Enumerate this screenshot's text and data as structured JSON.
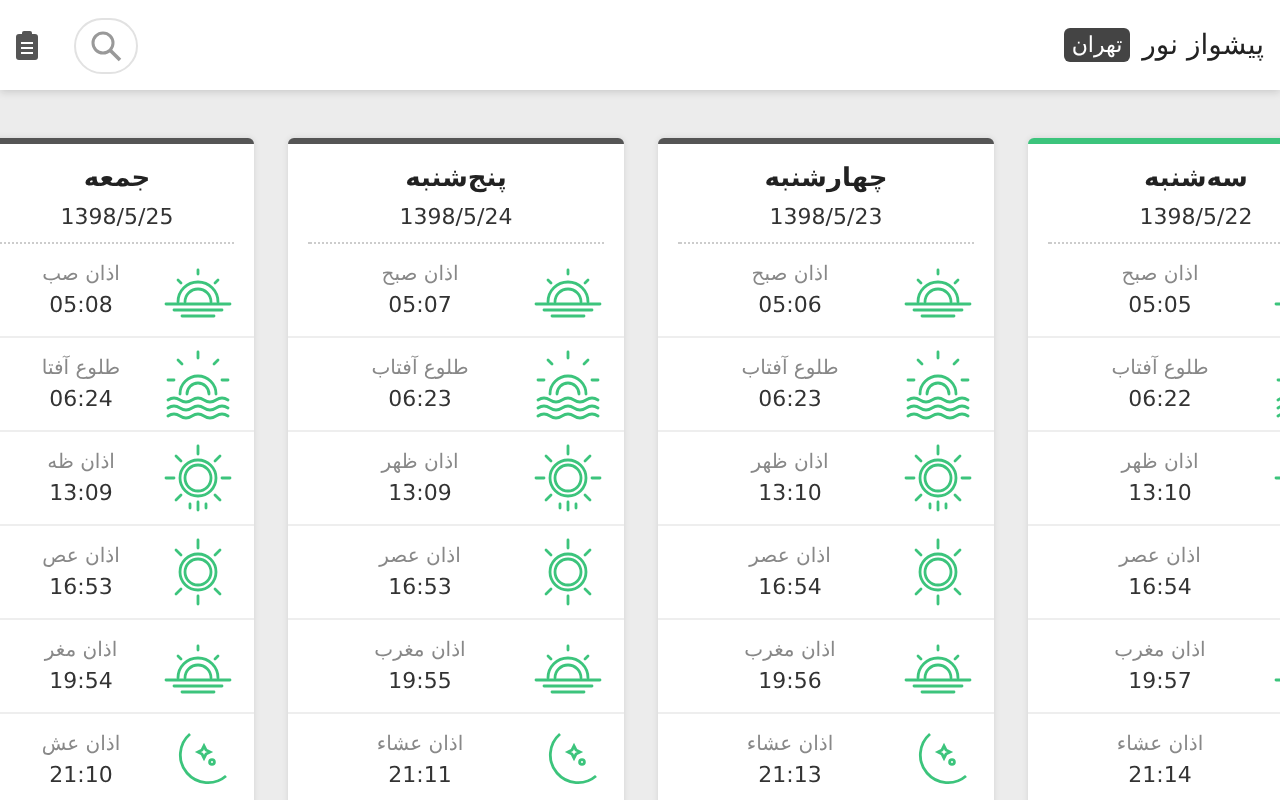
{
  "header": {
    "app_title": "پیشواز نور",
    "city": "تهران"
  },
  "days": [
    {
      "name": "سه‌شنبه",
      "date": "1398/5/22",
      "selected": true,
      "times": [
        {
          "kind": "dawn",
          "label": "اذان صبح",
          "time": "05:05"
        },
        {
          "kind": "sunrise",
          "label": "طلوع آفتاب",
          "time": "06:22"
        },
        {
          "kind": "noon",
          "label": "اذان ظهر",
          "time": "13:10"
        },
        {
          "kind": "afternoon",
          "label": "اذان عصر",
          "time": "16:54"
        },
        {
          "kind": "sunset",
          "label": "اذان مغرب",
          "time": "19:57"
        },
        {
          "kind": "night",
          "label": "اذان عشاء",
          "time": "21:14"
        }
      ]
    },
    {
      "name": "چهارشنبه",
      "date": "1398/5/23",
      "selected": false,
      "times": [
        {
          "kind": "dawn",
          "label": "اذان صبح",
          "time": "05:06"
        },
        {
          "kind": "sunrise",
          "label": "طلوع آفتاب",
          "time": "06:23"
        },
        {
          "kind": "noon",
          "label": "اذان ظهر",
          "time": "13:10"
        },
        {
          "kind": "afternoon",
          "label": "اذان عصر",
          "time": "16:54"
        },
        {
          "kind": "sunset",
          "label": "اذان مغرب",
          "time": "19:56"
        },
        {
          "kind": "night",
          "label": "اذان عشاء",
          "time": "21:13"
        }
      ]
    },
    {
      "name": "پنج‌شنبه",
      "date": "1398/5/24",
      "selected": false,
      "times": [
        {
          "kind": "dawn",
          "label": "اذان صبح",
          "time": "05:07"
        },
        {
          "kind": "sunrise",
          "label": "طلوع آفتاب",
          "time": "06:23"
        },
        {
          "kind": "noon",
          "label": "اذان ظهر",
          "time": "13:09"
        },
        {
          "kind": "afternoon",
          "label": "اذان عصر",
          "time": "16:53"
        },
        {
          "kind": "sunset",
          "label": "اذان مغرب",
          "time": "19:55"
        },
        {
          "kind": "night",
          "label": "اذان عشاء",
          "time": "21:11"
        }
      ]
    },
    {
      "name": "جمعه",
      "date": "1398/5/25",
      "selected": false,
      "times": [
        {
          "kind": "dawn",
          "label": "اذان صب",
          "time": "05:08"
        },
        {
          "kind": "sunrise",
          "label": "طلوع آفتا",
          "time": "06:24"
        },
        {
          "kind": "noon",
          "label": "اذان ظه",
          "time": "13:09"
        },
        {
          "kind": "afternoon",
          "label": "اذان عص",
          "time": "16:53"
        },
        {
          "kind": "sunset",
          "label": "اذان مغر",
          "time": "19:54"
        },
        {
          "kind": "night",
          "label": "اذان عش",
          "time": "21:10"
        }
      ]
    }
  ]
}
